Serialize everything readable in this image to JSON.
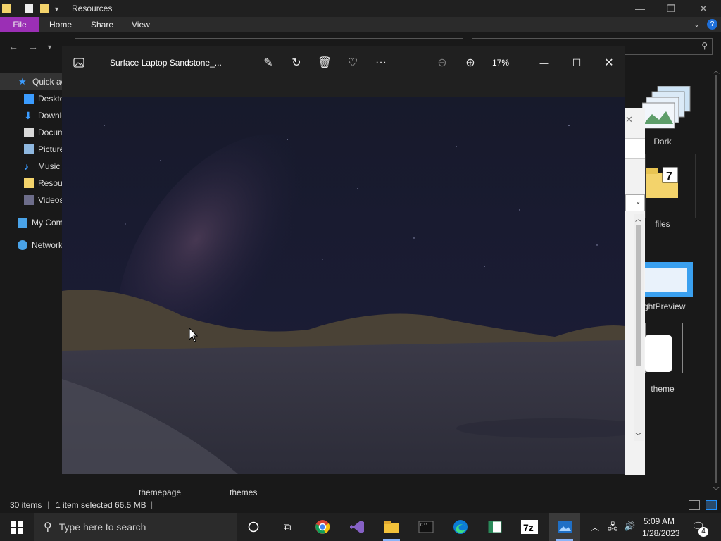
{
  "explorer": {
    "title": "Resources",
    "ribbon": {
      "file": "File",
      "home": "Home",
      "share": "Share",
      "view": "View"
    },
    "sidebar": [
      {
        "label": "Quick access",
        "icon": "star-icon"
      },
      {
        "label": "Desktop",
        "icon": "desktop-icon"
      },
      {
        "label": "Downloads",
        "icon": "download-icon"
      },
      {
        "label": "Documents",
        "icon": "documents-icon"
      },
      {
        "label": "Pictures",
        "icon": "pictures-icon"
      },
      {
        "label": "Music",
        "icon": "music-icon"
      },
      {
        "label": "Resources",
        "icon": "folder-icon"
      },
      {
        "label": "Videos",
        "icon": "videos-icon"
      },
      {
        "label": "My Computer",
        "icon": "computer-icon"
      },
      {
        "label": "Network",
        "icon": "network-icon"
      }
    ],
    "files": [
      {
        "label": "Dark"
      },
      {
        "label": "files"
      },
      {
        "label": "ghtPreview"
      },
      {
        "label": "theme"
      }
    ],
    "bottom_files": [
      "themepage",
      "themes"
    ],
    "status": {
      "items": "30 items",
      "selected": "1 item selected",
      "size": "66.5 MB"
    }
  },
  "photos": {
    "title": "Surface Laptop Sandstone_...",
    "zoom": "17%"
  },
  "taskbar": {
    "search_placeholder": "Type here to search",
    "time": "5:09 AM",
    "date": "1/28/2023",
    "notifications": "4"
  },
  "colors": {
    "file_tab": "#9b2fb5",
    "accent": "#1e90ff"
  }
}
